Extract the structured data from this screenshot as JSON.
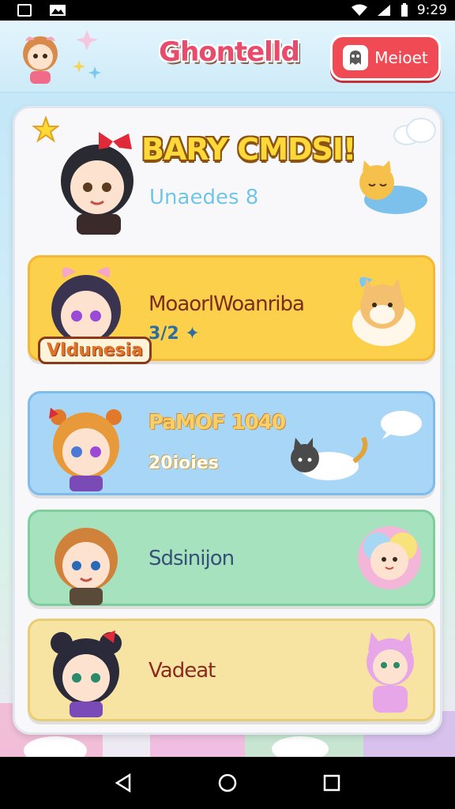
{
  "status_bar": {
    "time": "9:29",
    "icons": [
      "notification-box-icon",
      "photo-icon",
      "wifi-icon",
      "signal-icon",
      "battery-icon"
    ]
  },
  "header": {
    "title": "Ghontelld",
    "button_label": "Meioet",
    "button_icon": "ghost-icon",
    "colors": {
      "accent": "#f04a55",
      "header_bg": "#cdebf8"
    }
  },
  "hero": {
    "title": "BARY CMDSI!",
    "subtitle": "Unaedes 8",
    "icons": [
      "star-icon",
      "cloud-icon",
      "sleeping-cat-icon",
      "girl-avatar-icon"
    ]
  },
  "rows": [
    {
      "label": "MoaorlWoanriba",
      "meta": "3/2 ✦",
      "badge": "Vldunesia",
      "color": "#fcd04a",
      "pet": "dog-icon"
    },
    {
      "label": "PaMOF 1040",
      "meta": "20ioies",
      "color": "#a8d6f7",
      "pet": "cat-icon"
    },
    {
      "label": "Sdsinijon",
      "color": "#a6e2bd",
      "pet": "fluffy-creature-icon"
    },
    {
      "label": "Vadeat",
      "color": "#f8e4a2",
      "pet": "pink-cat-girl-icon"
    }
  ],
  "nav": {
    "items": [
      "back-icon",
      "home-icon",
      "recents-icon"
    ]
  }
}
